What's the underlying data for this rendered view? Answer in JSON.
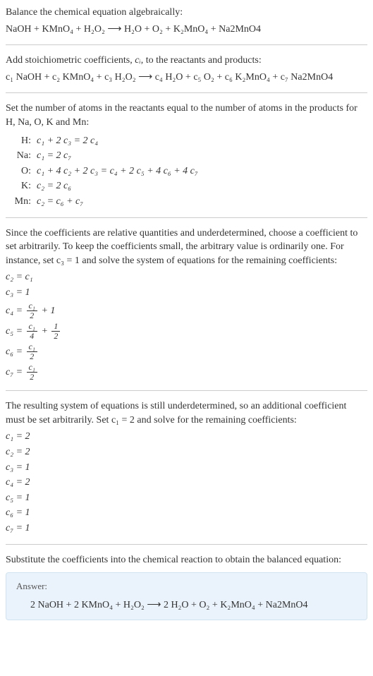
{
  "intro1": "Balance the chemical equation algebraically:",
  "eq1": "NaOH + KMnO₄ + H₂O₂  ⟶  H₂O + O₂ + K₂MnO₄ + Na2MnO4",
  "intro2_a": "Add stoichiometric coefficients, ",
  "intro2_var": "cᵢ",
  "intro2_b": ", to the reactants and products:",
  "eq2": "c₁ NaOH + c₂ KMnO₄ + c₃ H₂O₂  ⟶  c₄ H₂O + c₅ O₂ + c₆ K₂MnO₄ + c₇ Na2MnO4",
  "intro3": "Set the number of atoms in the reactants equal to the number of atoms in the products for H, Na, O, K and Mn:",
  "atoms": [
    {
      "label": "H:",
      "eq": "c₁ + 2 c₃ = 2 c₄"
    },
    {
      "label": "Na:",
      "eq": "c₁ = 2 c₇"
    },
    {
      "label": "O:",
      "eq": "c₁ + 4 c₂ + 2 c₃ = c₄ + 2 c₅ + 4 c₆ + 4 c₇"
    },
    {
      "label": "K:",
      "eq": "c₂ = 2 c₆"
    },
    {
      "label": "Mn:",
      "eq": "c₂ = c₆ + c₇"
    }
  ],
  "intro4": "Since the coefficients are relative quantities and underdetermined, choose a coefficient to set arbitrarily. To keep the coefficients small, the arbitrary value is ordinarily one. For instance, set c₃ = 1 and solve the system of equations for the remaining coefficients:",
  "coefs1": {
    "c2": "c₂ = c₁",
    "c3": "c₃ = 1",
    "c4_prefix": "c₄ = ",
    "c4_num": "c₁",
    "c4_den": "2",
    "c4_suffix": " + 1",
    "c5_prefix": "c₅ = ",
    "c5_num": "c₁",
    "c5_den": "4",
    "c5_plus": " + ",
    "c5_num2": "1",
    "c5_den2": "2",
    "c6_prefix": "c₆ = ",
    "c6_num": "c₁",
    "c6_den": "2",
    "c7_prefix": "c₇ = ",
    "c7_num": "c₁",
    "c7_den": "2"
  },
  "intro5": "The resulting system of equations is still underdetermined, so an additional coefficient must be set arbitrarily. Set c₁ = 2 and solve for the remaining coefficients:",
  "coefs2": [
    "c₁ = 2",
    "c₂ = 2",
    "c₃ = 1",
    "c₄ = 2",
    "c₅ = 1",
    "c₆ = 1",
    "c₇ = 1"
  ],
  "intro6": "Substitute the coefficients into the chemical reaction to obtain the balanced equation:",
  "answer_label": "Answer:",
  "answer_eq": "2 NaOH + 2 KMnO₄ + H₂O₂  ⟶  2 H₂O + O₂ + K₂MnO₄ + Na2MnO4"
}
